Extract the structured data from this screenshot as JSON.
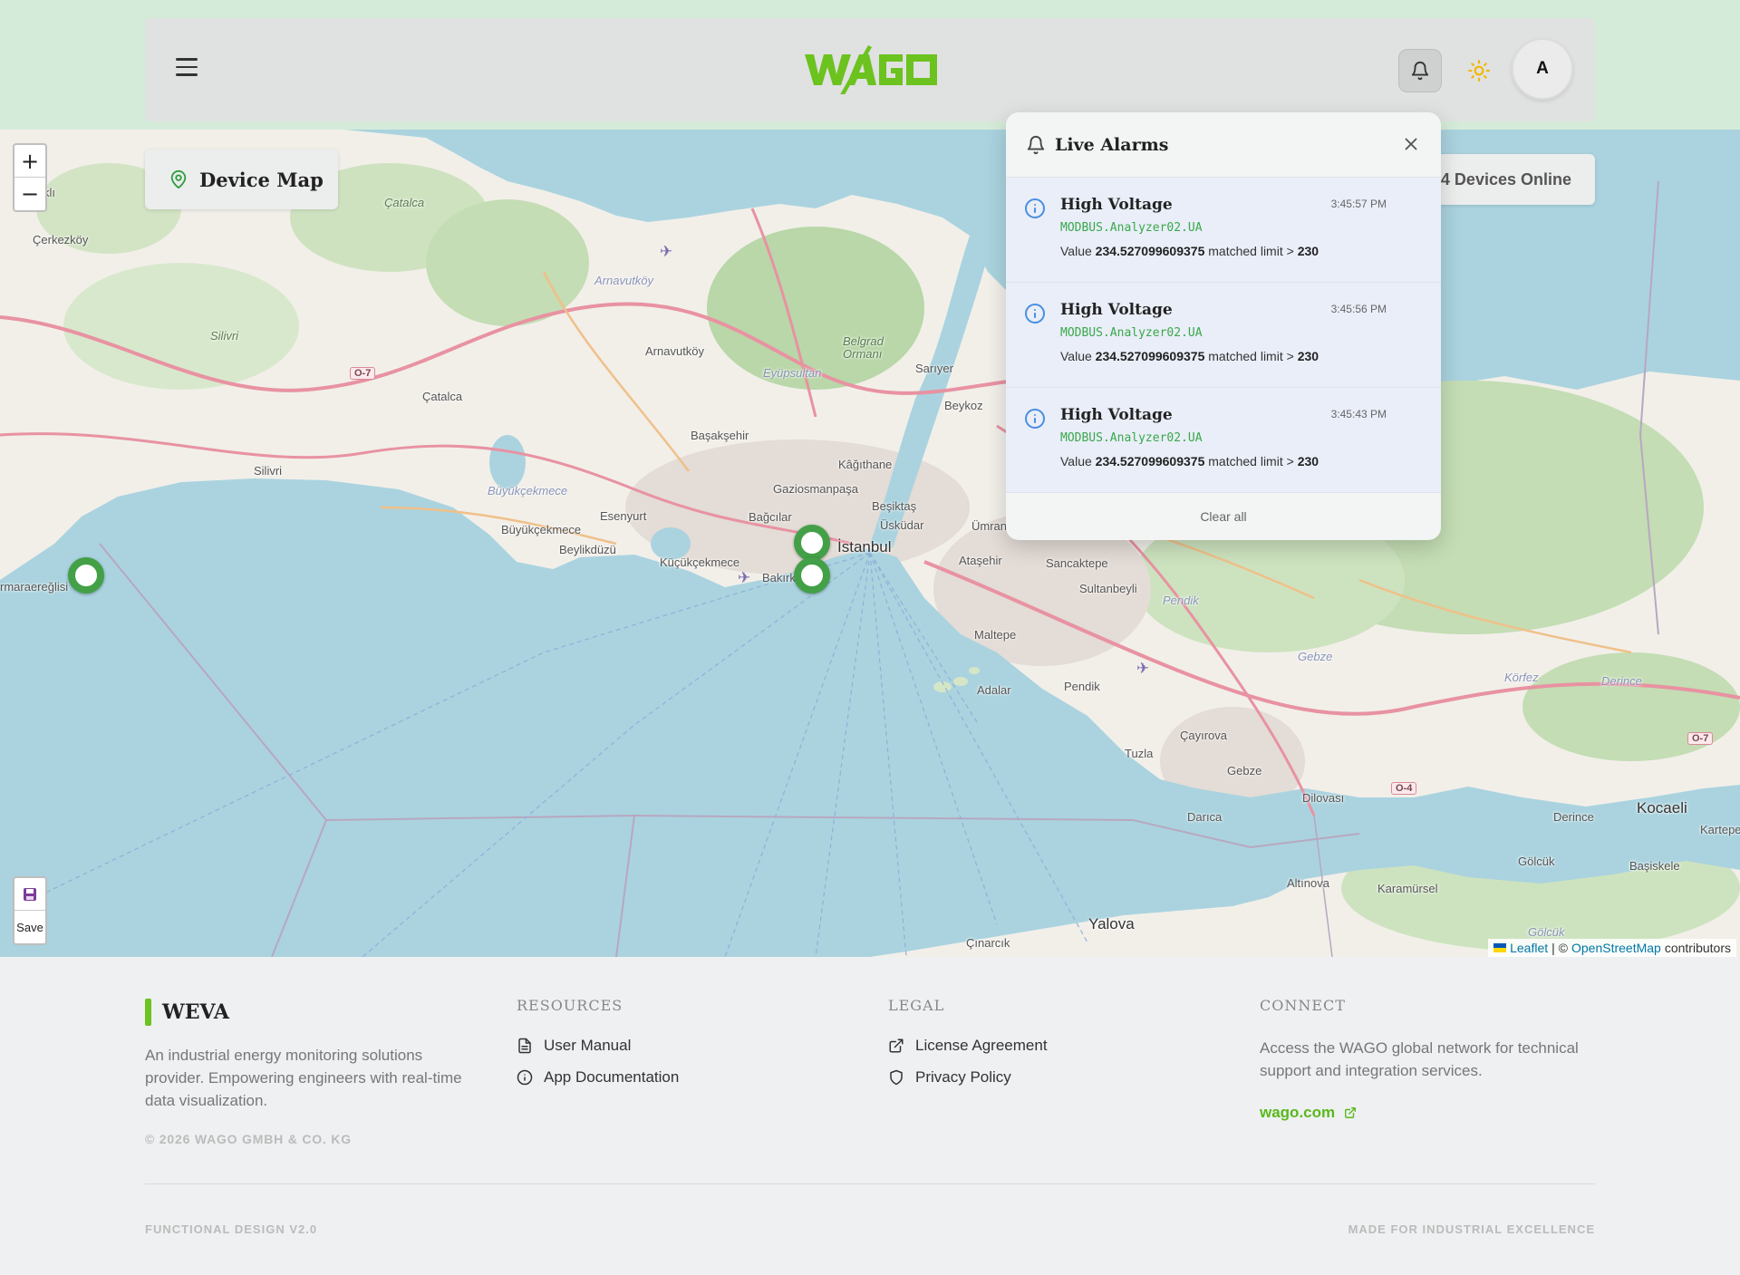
{
  "header": {
    "logo_text": "WAGO",
    "avatar_initial": "A",
    "icons": [
      "menu-icon",
      "bell-icon",
      "sun-icon"
    ]
  },
  "map": {
    "title": "Device Map",
    "devices_online": "4 Devices Online",
    "zoom_in": "+",
    "zoom_out": "−",
    "save_label": "Save",
    "attribution": {
      "leaflet": "Leaflet",
      "sep": "| ©",
      "osm": "OpenStreetMap",
      "suffix": "contributors"
    },
    "labels": {
      "istanbul": "İstanbul",
      "cerkezkoy": "Çerkezköy",
      "catalca_forest": "Çatalca",
      "catalca": "Çatalca",
      "silivri_forest": "Silivri",
      "silivri": "Silivri",
      "arnavutkoy_water": "Arnavutköy",
      "arnavutkoy": "Arnavutköy",
      "belgrad": "Belgrad Ormanı",
      "eyupsultan": "Eyüpsultan",
      "sariyer": "Sarıyer",
      "beykoz": "Beykoz",
      "basaksehir": "Başakşehir",
      "kagithane": "Kâğıthane",
      "gaziosmanpasa": "Gaziosmanpaşa",
      "besiktas": "Beşiktaş",
      "bagcilar": "Bağcılar",
      "esenyurt": "Esenyurt",
      "buyukcekmece_water": "Büyükçekmece",
      "buyukcekmece": "Büyükçekmece",
      "beylikduzu": "Beylikdüzü",
      "kucukcekmece": "Küçükçekmece",
      "bakirkoy": "Bakırk",
      "uskudar": "Üsküdar",
      "umraniye": "Ümraniye",
      "atasehir": "Ataşehir",
      "sancaktepe": "Sancaktepe",
      "sultanbeyli": "Sultanbeyli",
      "pendik_forest": "Pendik",
      "maltepe": "Maltepe",
      "adalar": "Adalar",
      "pendik": "Pendik",
      "gebze_forest": "Gebze",
      "korfez": "Körfez",
      "derince_forest": "Derince",
      "cayirova": "Çayırova",
      "tuzla": "Tuzla",
      "gebze": "Gebze",
      "dilovasi": "Dilovası",
      "darica": "Darıca",
      "derince": "Derince",
      "kocaeli": "Kocaeli",
      "kartepe": "Kartepe",
      "golcuk": "Gölcük",
      "basiskele": "Başiskele",
      "altinova": "Altınova",
      "karamursel": "Karamürsel",
      "yalova": "Yalova",
      "cinarcik": "Çınarcık",
      "golcuk_forest": "Gölcük",
      "marmaraereglisi": "rmaraereğlisi",
      "kli": "klı"
    },
    "road_shields": [
      "O-7",
      "O-7",
      "O-4"
    ]
  },
  "alarms": {
    "title": "Live Alarms",
    "clear_label": "Clear all",
    "items": [
      {
        "name": "High Voltage",
        "time": "3:45:57 PM",
        "tag": "MODBUS.Analyzer02.UA",
        "value_prefix": "Value",
        "value": "234.527099609375",
        "matched": "matched limit >",
        "limit": "230"
      },
      {
        "name": "High Voltage",
        "time": "3:45:56 PM",
        "tag": "MODBUS.Analyzer02.UA",
        "value_prefix": "Value",
        "value": "234.527099609375",
        "matched": "matched limit >",
        "limit": "230"
      },
      {
        "name": "High Voltage",
        "time": "3:45:43 PM",
        "tag": "MODBUS.Analyzer02.UA",
        "value_prefix": "Value",
        "value": "234.527099609375",
        "matched": "matched limit >",
        "limit": "230"
      }
    ]
  },
  "footer": {
    "brand": "WEVA",
    "about": "An industrial energy monitoring solutions provider. Empowering engineers with real-time data visualization.",
    "copyright": "© 2026 WAGO GMBH & CO. KG",
    "resources": {
      "heading": "RESOURCES",
      "user_manual": "User Manual",
      "app_docs": "App Documentation"
    },
    "legal": {
      "heading": "LEGAL",
      "license": "License Agreement",
      "privacy": "Privacy Policy"
    },
    "connect": {
      "heading": "CONNECT",
      "text": "Access the WAGO global network for technical support and integration services.",
      "link": "wago.com"
    },
    "version": "FUNCTIONAL DESIGN V2.0",
    "tagline": "MADE FOR INDUSTRIAL EXCELLENCE"
  },
  "colors": {
    "accent_green": "#6cc21e",
    "marker_green": "#43a047",
    "water": "#aad3df",
    "tag_green": "#3aa84a"
  }
}
